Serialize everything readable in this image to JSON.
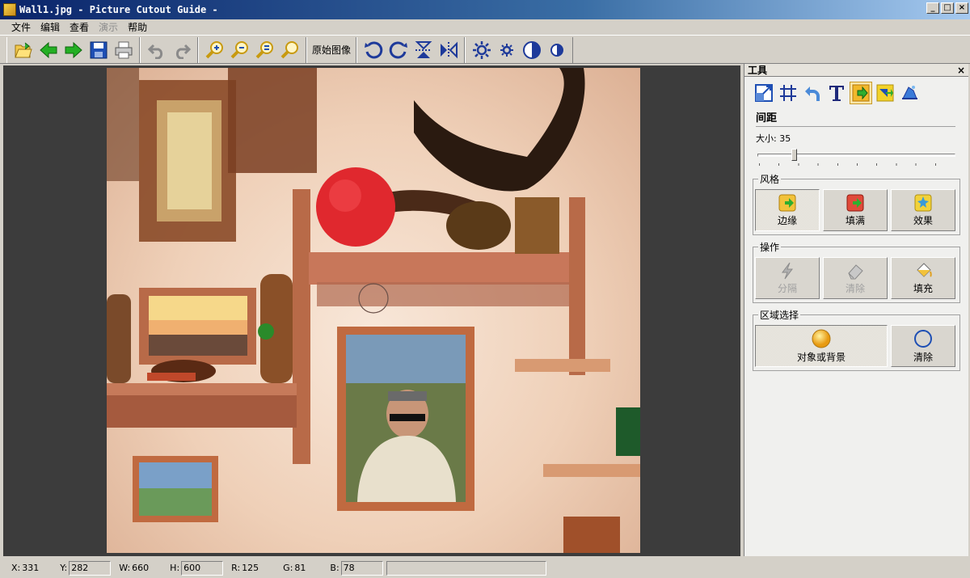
{
  "window": {
    "title": "Wall1.jpg - Picture Cutout Guide -",
    "minimize": "_",
    "maximize": "□",
    "close": "×"
  },
  "menu": [
    "文件",
    "编辑",
    "查看",
    "演示",
    "帮助"
  ],
  "toolbar": {
    "buttons": [
      "open-icon",
      "back-arrow-icon",
      "forward-arrow-icon",
      "save-icon",
      "print-icon",
      "undo-icon",
      "redo-icon",
      "zoom-in-icon",
      "zoom-out-icon",
      "zoom-fit-icon",
      "zoom-actual-icon",
      "rotate-left-icon",
      "rotate-right-icon",
      "flip-vertical-icon",
      "flip-horizontal-icon",
      "brightness-up-icon",
      "brightness-down-icon",
      "contrast-up-icon",
      "contrast-down-icon"
    ],
    "original_image_label": "原始图像"
  },
  "panel": {
    "title": "工具",
    "close": "×",
    "section_title": "间距",
    "size_label": "大小: 35",
    "size_value": 35,
    "size_max": 200,
    "style_group": {
      "legend": "风格",
      "buttons": [
        "边缘",
        "填满",
        "效果"
      ]
    },
    "ops_group": {
      "legend": "操作",
      "buttons": [
        "分隔",
        "清除",
        "填充"
      ]
    },
    "region_group": {
      "legend": "区域选择",
      "buttons": [
        "对象或背景",
        "清除"
      ]
    }
  },
  "status": {
    "x_label": "X:",
    "x": "331",
    "y_label": "Y:",
    "y": "282",
    "w_label": "W:",
    "w": "660",
    "h_label": "H:",
    "h": "600",
    "r_label": "R:",
    "r": "125",
    "g_label": "G:",
    "g": "81",
    "b_label": "B:",
    "b": "78"
  }
}
